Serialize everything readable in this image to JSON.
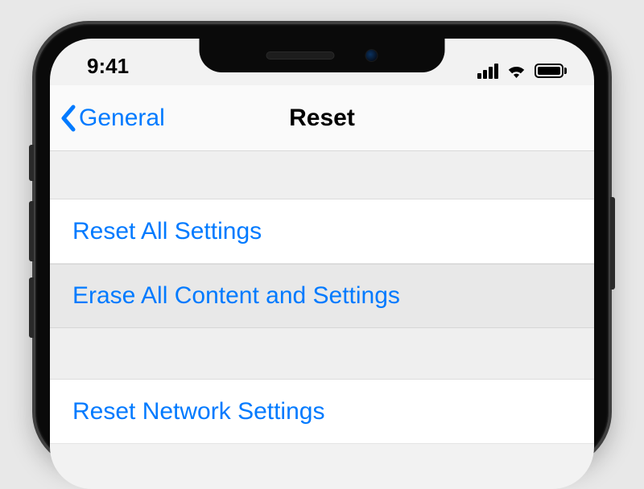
{
  "status": {
    "time": "9:41"
  },
  "nav": {
    "back_label": "General",
    "title": "Reset"
  },
  "options": {
    "reset_all": "Reset All Settings",
    "erase_all": "Erase All Content and Settings",
    "reset_network": "Reset Network Settings"
  },
  "colors": {
    "link": "#007aff",
    "bg": "#f2f2f2"
  }
}
